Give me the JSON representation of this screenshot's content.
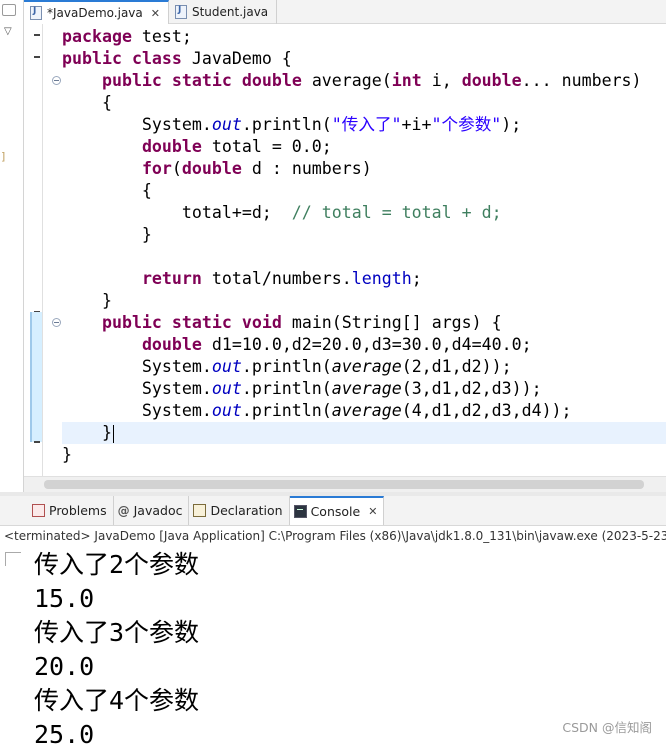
{
  "editor_tabs": [
    {
      "label": "*JavaDemo.java",
      "close": "✕"
    },
    {
      "label": "Student.java"
    }
  ],
  "code_lines": [
    [
      {
        "c": "kw",
        "t": "package"
      },
      {
        "t": " test;"
      }
    ],
    [
      {
        "c": "kw",
        "t": "public"
      },
      {
        "t": " "
      },
      {
        "c": "kw",
        "t": "class"
      },
      {
        "t": " JavaDemo {"
      }
    ],
    [
      {
        "t": "    "
      },
      {
        "c": "kw",
        "t": "public"
      },
      {
        "t": " "
      },
      {
        "c": "kw",
        "t": "static"
      },
      {
        "t": " "
      },
      {
        "c": "kw",
        "t": "double"
      },
      {
        "t": " average("
      },
      {
        "c": "kw",
        "t": "int"
      },
      {
        "t": " i, "
      },
      {
        "c": "kw",
        "t": "double"
      },
      {
        "t": "... numbers)"
      }
    ],
    [
      {
        "t": "    {"
      }
    ],
    [
      {
        "t": "        System."
      },
      {
        "c": "fld",
        "t": "out"
      },
      {
        "t": ".println("
      },
      {
        "c": "str",
        "t": "\"传入了\""
      },
      {
        "t": "+i+"
      },
      {
        "c": "str",
        "t": "\"个参数\""
      },
      {
        "t": ");"
      }
    ],
    [
      {
        "t": "        "
      },
      {
        "c": "kw",
        "t": "double"
      },
      {
        "t": " total = 0.0;"
      }
    ],
    [
      {
        "t": "        "
      },
      {
        "c": "kw",
        "t": "for"
      },
      {
        "t": "("
      },
      {
        "c": "kw",
        "t": "double"
      },
      {
        "t": " d : numbers)"
      }
    ],
    [
      {
        "t": "        {"
      }
    ],
    [
      {
        "t": "            total+=d;  "
      },
      {
        "c": "cmt",
        "t": "// total = total + d;"
      }
    ],
    [
      {
        "t": "        }"
      }
    ],
    [
      {
        "t": ""
      }
    ],
    [
      {
        "t": "        "
      },
      {
        "c": "kw",
        "t": "return"
      },
      {
        "t": " total/numbers."
      },
      {
        "c": "fld2",
        "t": "length"
      },
      {
        "t": ";"
      }
    ],
    [
      {
        "t": "    }"
      }
    ],
    [
      {
        "t": "    "
      },
      {
        "c": "kw",
        "t": "public"
      },
      {
        "t": " "
      },
      {
        "c": "kw",
        "t": "static"
      },
      {
        "t": " "
      },
      {
        "c": "kw",
        "t": "void"
      },
      {
        "t": " main(String[] args) {"
      }
    ],
    [
      {
        "t": "        "
      },
      {
        "c": "kw",
        "t": "double"
      },
      {
        "t": " d1=10.0,d2=20.0,d3=30.0,d4=40.0;"
      }
    ],
    [
      {
        "t": "        System."
      },
      {
        "c": "fld",
        "t": "out"
      },
      {
        "t": ".println("
      },
      {
        "c": "ital",
        "t": "average"
      },
      {
        "t": "(2,d1,d2));"
      }
    ],
    [
      {
        "t": "        System."
      },
      {
        "c": "fld",
        "t": "out"
      },
      {
        "t": ".println("
      },
      {
        "c": "ital",
        "t": "average"
      },
      {
        "t": "(3,d1,d2,d3));"
      }
    ],
    [
      {
        "t": "        System."
      },
      {
        "c": "fld",
        "t": "out"
      },
      {
        "t": ".println("
      },
      {
        "c": "ital",
        "t": "average"
      },
      {
        "t": "(4,d1,d2,d3,d4));"
      }
    ],
    [
      {
        "t": "    }"
      }
    ],
    [
      {
        "t": "}"
      }
    ]
  ],
  "view_tabs": [
    {
      "label": "Problems"
    },
    {
      "label": "Javadoc",
      "icon": "@"
    },
    {
      "label": "Declaration"
    },
    {
      "label": "Console",
      "close": "✕"
    }
  ],
  "console": {
    "status": "<terminated> JavaDemo [Java Application] C:\\Program Files (x86)\\Java\\jdk1.8.0_131\\bin\\javaw.exe (2023-5-23",
    "output": [
      "传入了2个参数",
      "15.0",
      "传入了3个参数",
      "20.0",
      "传入了4个参数",
      "25.0"
    ]
  },
  "watermark": "CSDN @信知阁",
  "colors": {
    "keyword": "#7f0055",
    "field": "#0000c0",
    "string": "#2a00ff",
    "comment": "#3f7f5f",
    "current_line": "#e8f2fe"
  }
}
